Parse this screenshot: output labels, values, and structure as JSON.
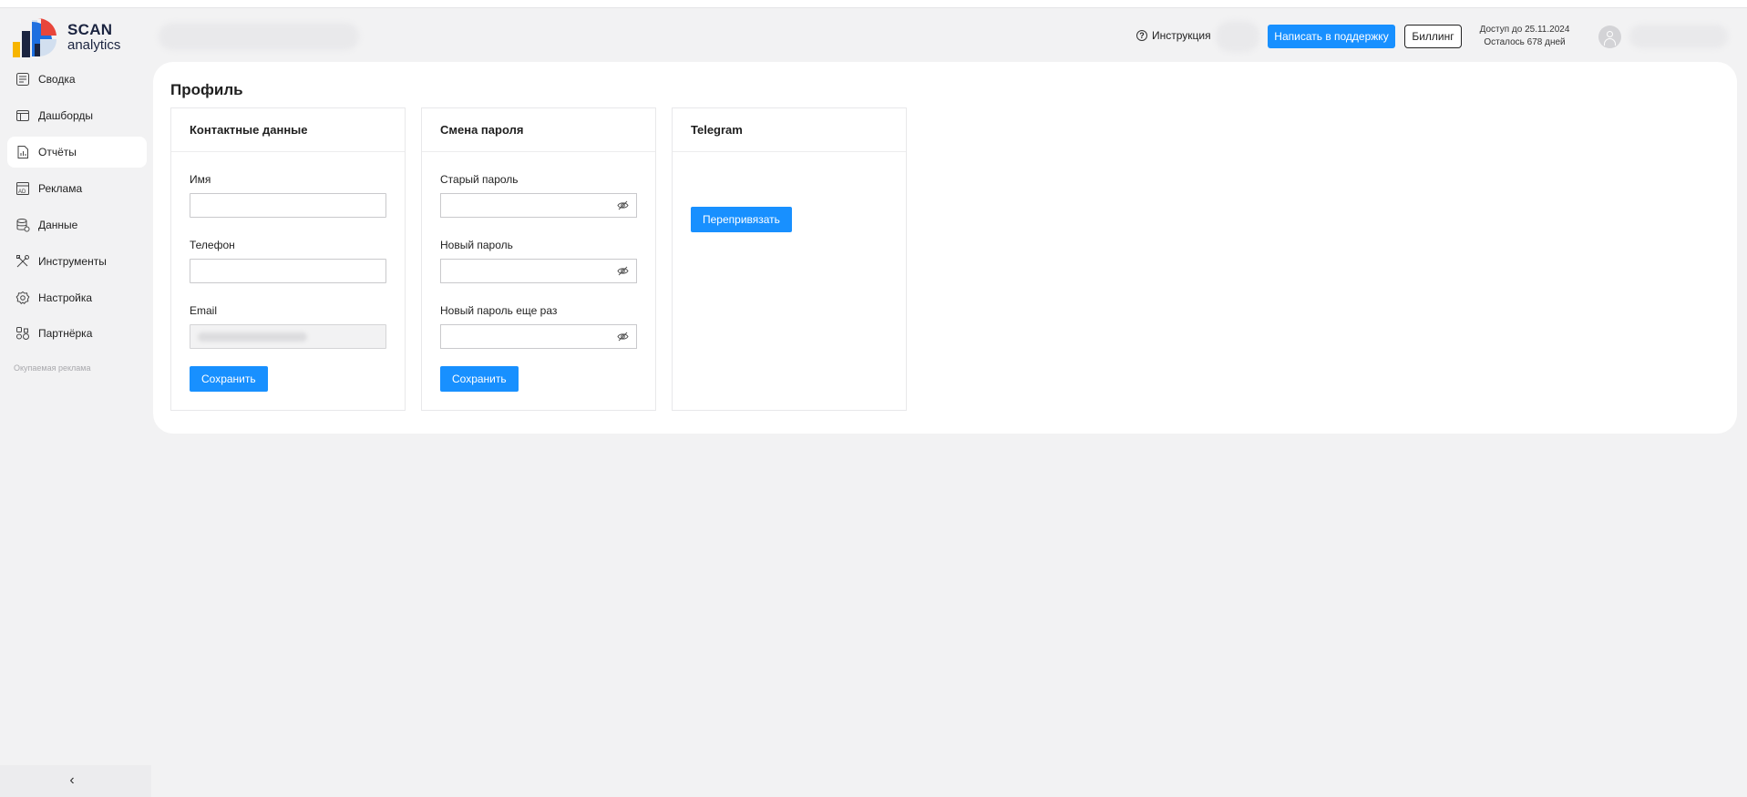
{
  "brand": {
    "line1": "SCAN",
    "line2": "analytics",
    "colors": {
      "navy": "#1b2440",
      "blue": "#1d6fe0",
      "red": "#e8463b",
      "yellow": "#f7b500"
    }
  },
  "header": {
    "help_label": "Инструкция",
    "help_icon": "question-circle-icon",
    "support_label": "Написать в поддержку",
    "billing_label": "Биллинг",
    "access_line1": "Доступ до 25.11.2024",
    "access_line2": "Осталось 678 дней",
    "avatar_icon": "user-avatar-icon"
  },
  "sidebar": {
    "items": [
      {
        "label": "Сводка",
        "icon": "summary-icon",
        "active": false
      },
      {
        "label": "Дашборды",
        "icon": "dashboard-icon",
        "active": false
      },
      {
        "label": "Отчёты",
        "icon": "report-icon",
        "active": true
      },
      {
        "label": "Реклама",
        "icon": "ad-icon",
        "active": false
      },
      {
        "label": "Данные",
        "icon": "database-icon",
        "active": false
      },
      {
        "label": "Инструменты",
        "icon": "tools-icon",
        "active": false
      },
      {
        "label": "Настройка",
        "icon": "settings-icon",
        "active": false
      },
      {
        "label": "Партнёрка",
        "icon": "partner-icon",
        "active": false
      }
    ],
    "section_label": "Окупаемая реклама",
    "collapse_icon": "chevron-left-icon"
  },
  "page": {
    "title": "Профиль",
    "contact": {
      "heading": "Контактные данные",
      "name_label": "Имя",
      "name_value": "",
      "phone_label": "Телефон",
      "phone_value": "",
      "email_label": "Email",
      "save_label": "Сохранить"
    },
    "password": {
      "heading": "Смена пароля",
      "old_label": "Старый пароль",
      "new_label": "Новый пароль",
      "repeat_label": "Новый пароль еще раз",
      "save_label": "Сохранить",
      "visibility_icon": "eye-off-icon"
    },
    "telegram": {
      "heading": "Telegram",
      "rebind_label": "Перепривязать"
    }
  },
  "colors": {
    "accent": "#1890ff",
    "background": "#f2f2f3",
    "card": "#ffffff"
  }
}
